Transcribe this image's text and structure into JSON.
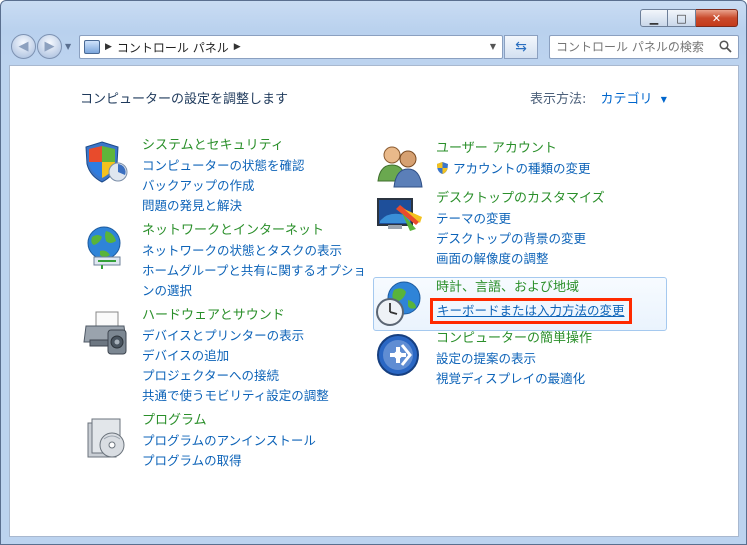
{
  "window": {
    "caption": {
      "minimize": "▁",
      "maximize": "□",
      "close": "✕"
    }
  },
  "nav": {
    "breadcrumb": "コントロール パネル",
    "search_placeholder": "コントロール パネルの検索"
  },
  "header": {
    "title": "コンピューターの設定を調整します",
    "view_by_label": "表示方法:",
    "view_by_value": "カテゴリ"
  },
  "left_categories": [
    {
      "icon": "shield-icon",
      "title": "システムとセキュリティ",
      "links": [
        "コンピューターの状態を確認",
        "バックアップの作成",
        "問題の発見と解決"
      ]
    },
    {
      "icon": "network-globe-icon",
      "title": "ネットワークとインターネット",
      "links": [
        "ネットワークの状態とタスクの表示",
        "ホームグループと共有に関するオプショ",
        "ンの選択"
      ]
    },
    {
      "icon": "printer-icon",
      "title": "ハードウェアとサウンド",
      "links": [
        "デバイスとプリンターの表示",
        "デバイスの追加",
        "プロジェクターへの接続",
        "共通で使うモビリティ設定の調整"
      ]
    },
    {
      "icon": "programs-icon",
      "title": "プログラム",
      "links": [
        "プログラムのアンインストール",
        "プログラムの取得"
      ]
    }
  ],
  "right_categories": [
    {
      "icon": "users-icon",
      "title": "ユーザー アカウント",
      "links": [
        "アカウントの種類の変更"
      ]
    },
    {
      "icon": "desktop-paint-icon",
      "title": "デスクトップのカスタマイズ",
      "links": [
        "テーマの変更",
        "デスクトップの背景の変更",
        "画面の解像度の調整"
      ]
    },
    {
      "icon": "clock-globe-icon",
      "title": "時計、言語、および地域",
      "links": [
        "キーボードまたは入力方法の変更"
      ]
    },
    {
      "icon": "ease-of-access-icon",
      "title": "コンピューターの簡単操作",
      "links": [
        "設定の提案の表示",
        "視覚ディスプレイの最適化"
      ]
    }
  ],
  "colors": {
    "category_title": "#2a8f2a",
    "link": "#0d63b8",
    "highlight_border": "#ff2a00"
  }
}
